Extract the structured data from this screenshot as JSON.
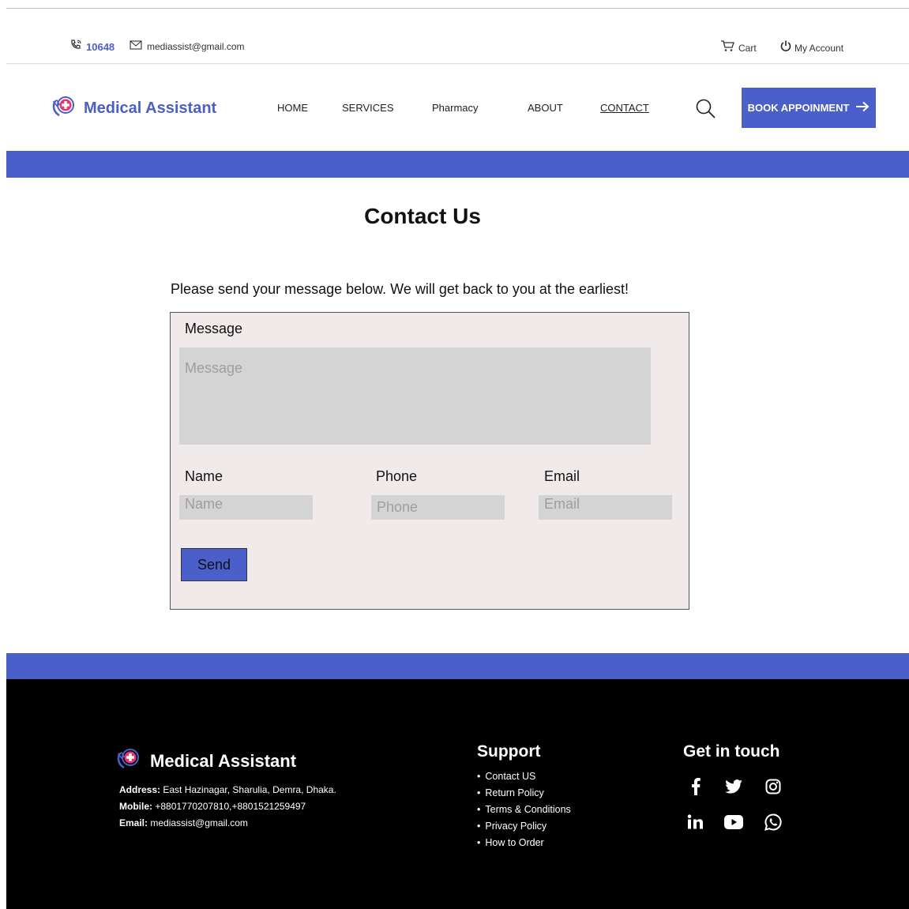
{
  "topbar": {
    "phone": "10648",
    "email": "mediassist@gmail.com",
    "cart": "Cart",
    "account": "My Account"
  },
  "header": {
    "brand": "Medical Assistant",
    "nav": [
      "HOME",
      "SERVICES",
      "Pharmacy",
      "ABOUT",
      "CONTACT"
    ],
    "active_nav": "CONTACT",
    "book_label": "BOOK APPOINMENT"
  },
  "main": {
    "title": "Contact Us",
    "intro": "Please send your message below. We will get back to you at the earliest!",
    "form": {
      "message_label": "Message",
      "message_placeholder": "Message",
      "name_label": "Name",
      "name_placeholder": "Name",
      "phone_label": "Phone",
      "phone_placeholder": "Phone",
      "email_label": "Email",
      "email_placeholder": "Email",
      "send_label": "Send"
    }
  },
  "footer": {
    "brand": "Medical Assistant",
    "address_label": "Address:",
    "address": "East Hazinagar, Sharulia, Demra, Dhaka.",
    "mobile_label": "Mobile:",
    "mobile": "+8801770207810,+8801521259497",
    "email_label": "Email:",
    "email": "mediassist@gmail.com",
    "support_heading": "Support",
    "support_links": [
      "Contact US",
      "Return Policy",
      "Terms & Conditions",
      "Privacy Policy",
      "How to Order"
    ],
    "touch_heading": "Get in touch",
    "social_icons": [
      "facebook-icon",
      "twitter-icon",
      "instagram-icon",
      "linkedin-icon",
      "youtube-icon",
      "whatsapp-icon"
    ]
  },
  "colors": {
    "brand": "#4a5fc9",
    "footer_bg": "#000000",
    "form_bg": "#f0ebea",
    "input_bg": "#d4d4d4",
    "logo_cross": "#e8336e"
  }
}
